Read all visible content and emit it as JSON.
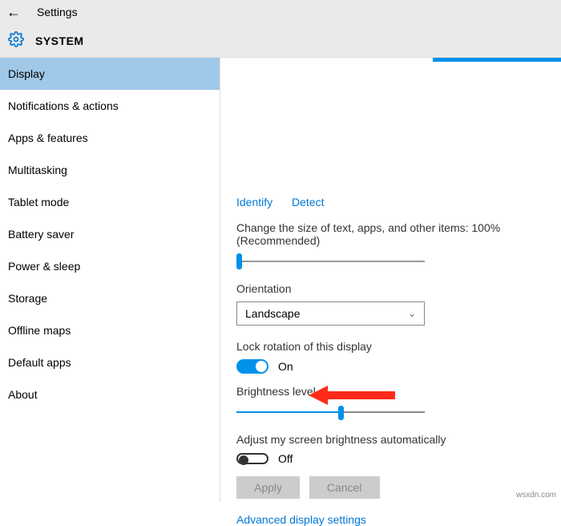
{
  "titlebar": {
    "title": "Settings"
  },
  "header": {
    "title": "SYSTEM"
  },
  "sidebar": {
    "items": [
      {
        "label": "Display",
        "active": true
      },
      {
        "label": "Notifications & actions"
      },
      {
        "label": "Apps & features"
      },
      {
        "label": "Multitasking"
      },
      {
        "label": "Tablet mode"
      },
      {
        "label": "Battery saver"
      },
      {
        "label": "Power & sleep"
      },
      {
        "label": "Storage"
      },
      {
        "label": "Offline maps"
      },
      {
        "label": "Default apps"
      },
      {
        "label": "About"
      }
    ]
  },
  "content": {
    "links": {
      "identify": "Identify",
      "detect": "Detect"
    },
    "scale_label": "Change the size of text, apps, and other items: 100% (Recommended)",
    "orientation_label": "Orientation",
    "orientation_value": "Landscape",
    "lock_label": "Lock rotation of this display",
    "lock_value": "On",
    "brightness_label": "Brightness level",
    "auto_bright_label": "Adjust my screen brightness automatically",
    "auto_bright_value": "Off",
    "apply": "Apply",
    "cancel": "Cancel",
    "advanced": "Advanced display settings"
  },
  "watermark": "wsxdn.com"
}
